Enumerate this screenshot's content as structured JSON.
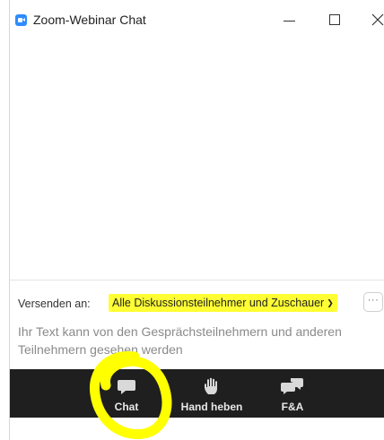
{
  "window": {
    "title": "Zoom-Webinar Chat",
    "app_icon": "zoom-icon",
    "minimize_icon": "minimize-icon",
    "maximize_icon": "maximize-icon",
    "close_icon": "close-icon"
  },
  "composer": {
    "send_to_label": "Versenden an:",
    "recipient_selected": "Alle Diskussionsteilnehmer und Zuschauer",
    "recipient_highlight_color": "#ffff33",
    "more_label": "···",
    "hint_text": "Ihr Text kann von den Gesprächsteilnehmern und anderen Teilnehmern gesehen werden"
  },
  "toolbar": {
    "background": "#1f1f1f",
    "items": [
      {
        "label": "Chat",
        "icon": "chat-bubble-icon"
      },
      {
        "label": "Hand heben",
        "icon": "raise-hand-icon"
      },
      {
        "label": "F&A",
        "icon": "qa-bubbles-icon"
      }
    ]
  },
  "annotation": {
    "color": "#ffff00",
    "shape": "circle-around-chat-button"
  }
}
